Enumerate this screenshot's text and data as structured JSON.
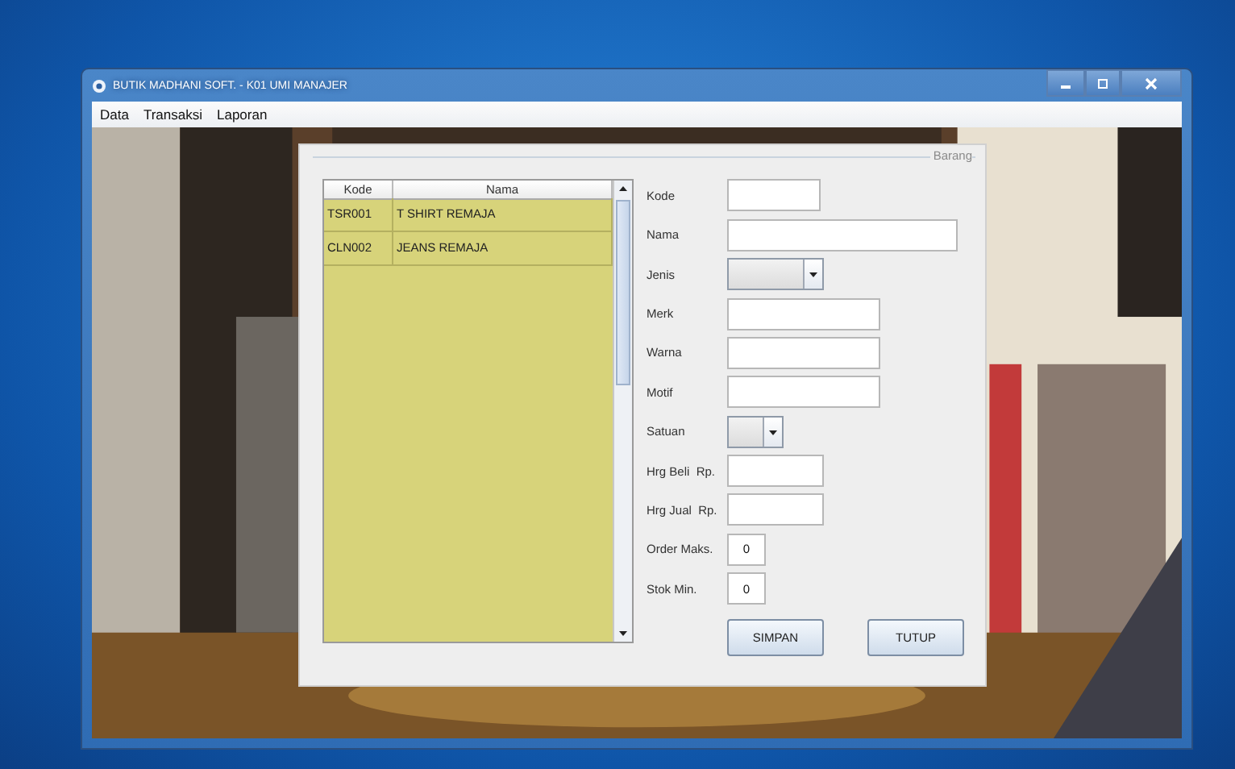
{
  "window": {
    "title": "BUTIK MADHANI SOFT. - K01 UMI MANAJER"
  },
  "menu": [
    {
      "label": "Data"
    },
    {
      "label": "Transaksi"
    },
    {
      "label": "Laporan"
    }
  ],
  "panel": {
    "title": "Barang"
  },
  "table": {
    "columns": [
      "Kode",
      "Nama"
    ],
    "rows": [
      [
        "TSR001",
        "T SHIRT REMAJA"
      ],
      [
        "CLN002",
        "JEANS REMAJA"
      ]
    ]
  },
  "form": [
    {
      "label": "Kode",
      "kind": "text"
    },
    {
      "label": "Nama",
      "kind": "text"
    },
    {
      "label": "Jenis",
      "kind": "combo"
    },
    {
      "label": "Merk",
      "kind": "text"
    },
    {
      "label": "Warna",
      "kind": "text"
    },
    {
      "label": "Motif",
      "kind": "text"
    },
    {
      "label": "Satuan",
      "kind": "combo"
    },
    {
      "label": "Hrg Beli  Rp.",
      "kind": "text"
    },
    {
      "label": "Hrg Jual  Rp.",
      "kind": "text"
    },
    {
      "label": "Order Maks.",
      "kind": "number",
      "value": "0"
    },
    {
      "label": "Stok Min.",
      "kind": "number",
      "value": "0"
    }
  ],
  "buttons": [
    "SIMPAN",
    "TUTUP"
  ]
}
